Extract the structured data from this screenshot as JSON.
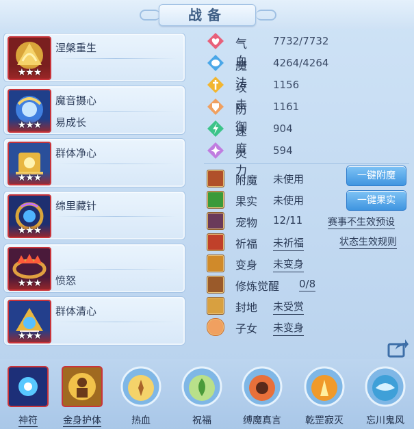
{
  "title": "战备",
  "skills": [
    {
      "name": "涅槃重生",
      "sub": "",
      "stars": "★★★"
    },
    {
      "name": "魔音摄心",
      "sub": "易成长",
      "stars": "★★★"
    },
    {
      "name": "群体净心",
      "sub": "",
      "stars": "★★★"
    },
    {
      "name": "绵里藏针",
      "sub": "",
      "stars": "★★★"
    },
    {
      "name": "",
      "sub": "愤怒",
      "stars": "★★★"
    },
    {
      "name": "群体清心",
      "sub": "",
      "stars": "★★★"
    }
  ],
  "stats": [
    {
      "label": "气血",
      "value": "7732/7732",
      "icon": "heart-icon",
      "color": "#e8607a"
    },
    {
      "label": "魔法",
      "value": "4264/4264",
      "icon": "mana-icon",
      "color": "#4aa7e8"
    },
    {
      "label": "攻击",
      "value": "1156",
      "icon": "sword-icon",
      "color": "#f2b630"
    },
    {
      "label": "防御",
      "value": "1161",
      "icon": "shield-icon",
      "color": "#f0a060"
    },
    {
      "label": "速度",
      "value": "904",
      "icon": "speed-icon",
      "color": "#3cc48a"
    },
    {
      "label": "灵力",
      "value": "594",
      "icon": "spirit-icon",
      "color": "#c07de0"
    }
  ],
  "extras": [
    {
      "label": "附魔",
      "value": "未使用",
      "underline": false,
      "icon": "enchant-icon"
    },
    {
      "label": "果实",
      "value": "未使用",
      "underline": false,
      "icon": "fruit-icon"
    },
    {
      "label": "宠物",
      "value": "12/11",
      "underline": false,
      "icon": "pet-icon"
    },
    {
      "label": "祈福",
      "value": "未祈福",
      "underline": true,
      "icon": "blessing-icon"
    },
    {
      "label": "变身",
      "value": "未变身",
      "underline": true,
      "icon": "transform-icon"
    },
    {
      "label": "修炼觉醒",
      "value": "0/8",
      "underline": true,
      "icon": "cultivation-icon"
    },
    {
      "label": "封地",
      "value": "未受赏",
      "underline": true,
      "icon": "fief-icon"
    },
    {
      "label": "子女",
      "value": "未变身",
      "underline": true,
      "icon": "children-icon"
    }
  ],
  "buttons": {
    "enchant": "一键附魔",
    "fruit": "一键果实"
  },
  "links": {
    "rules_invalid": "赛事不生效预设",
    "rules_effect": "状态生效规则"
  },
  "bottom": [
    {
      "label": "神符",
      "underline": true
    },
    {
      "label": "金身护体",
      "underline": true
    },
    {
      "label": "热血",
      "underline": false
    },
    {
      "label": "祝福",
      "underline": false
    },
    {
      "label": "缚魔真言",
      "underline": false
    },
    {
      "label": "乾罡寂灭",
      "underline": false
    },
    {
      "label": "忘川鬼风",
      "underline": false
    }
  ]
}
